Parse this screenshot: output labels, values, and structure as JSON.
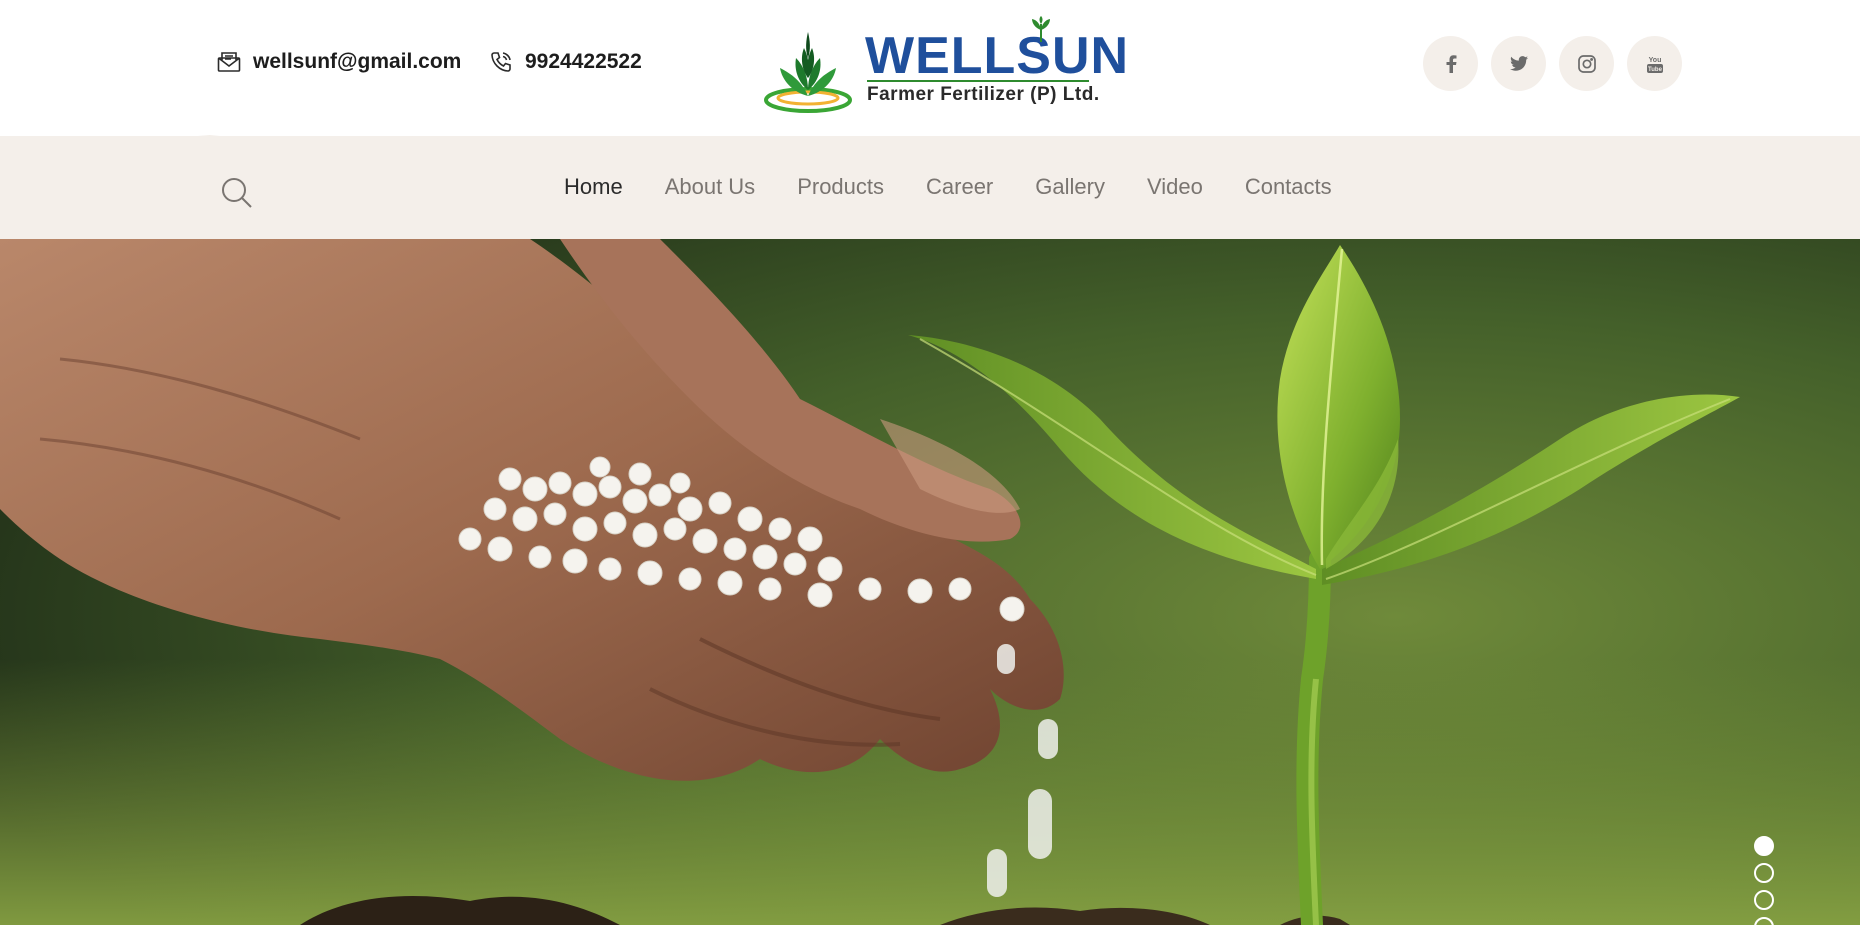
{
  "header": {
    "email": "wellsunf@gmail.com",
    "phone": "9924422522",
    "logo": {
      "name": "WELLSUN",
      "tagline": "Farmer Fertilizer (P) Ltd."
    },
    "socials": [
      {
        "icon": "facebook-icon",
        "glyph": "f"
      },
      {
        "icon": "twitter-icon",
        "glyph": "t"
      },
      {
        "icon": "instagram-icon",
        "glyph": "ig"
      },
      {
        "icon": "youtube-icon",
        "glyph": "yt"
      }
    ]
  },
  "nav": {
    "items": [
      {
        "label": "Home",
        "active": true
      },
      {
        "label": "About Us",
        "active": false
      },
      {
        "label": "Products",
        "active": false
      },
      {
        "label": "Career",
        "active": false
      },
      {
        "label": "Gallery",
        "active": false
      },
      {
        "label": "Video",
        "active": false
      },
      {
        "label": "Contacts",
        "active": false
      }
    ]
  },
  "hero": {
    "image": "hand-pouring-fertilizer-granules-on-seedling",
    "slides_total": 4,
    "active_slide": 1
  },
  "colors": {
    "brand_blue": "#1f4f9c",
    "brand_green": "#2e8b2e",
    "nav_bg": "#f4efea",
    "nav_text": "#7a7571",
    "nav_active": "#2b2b2b"
  }
}
